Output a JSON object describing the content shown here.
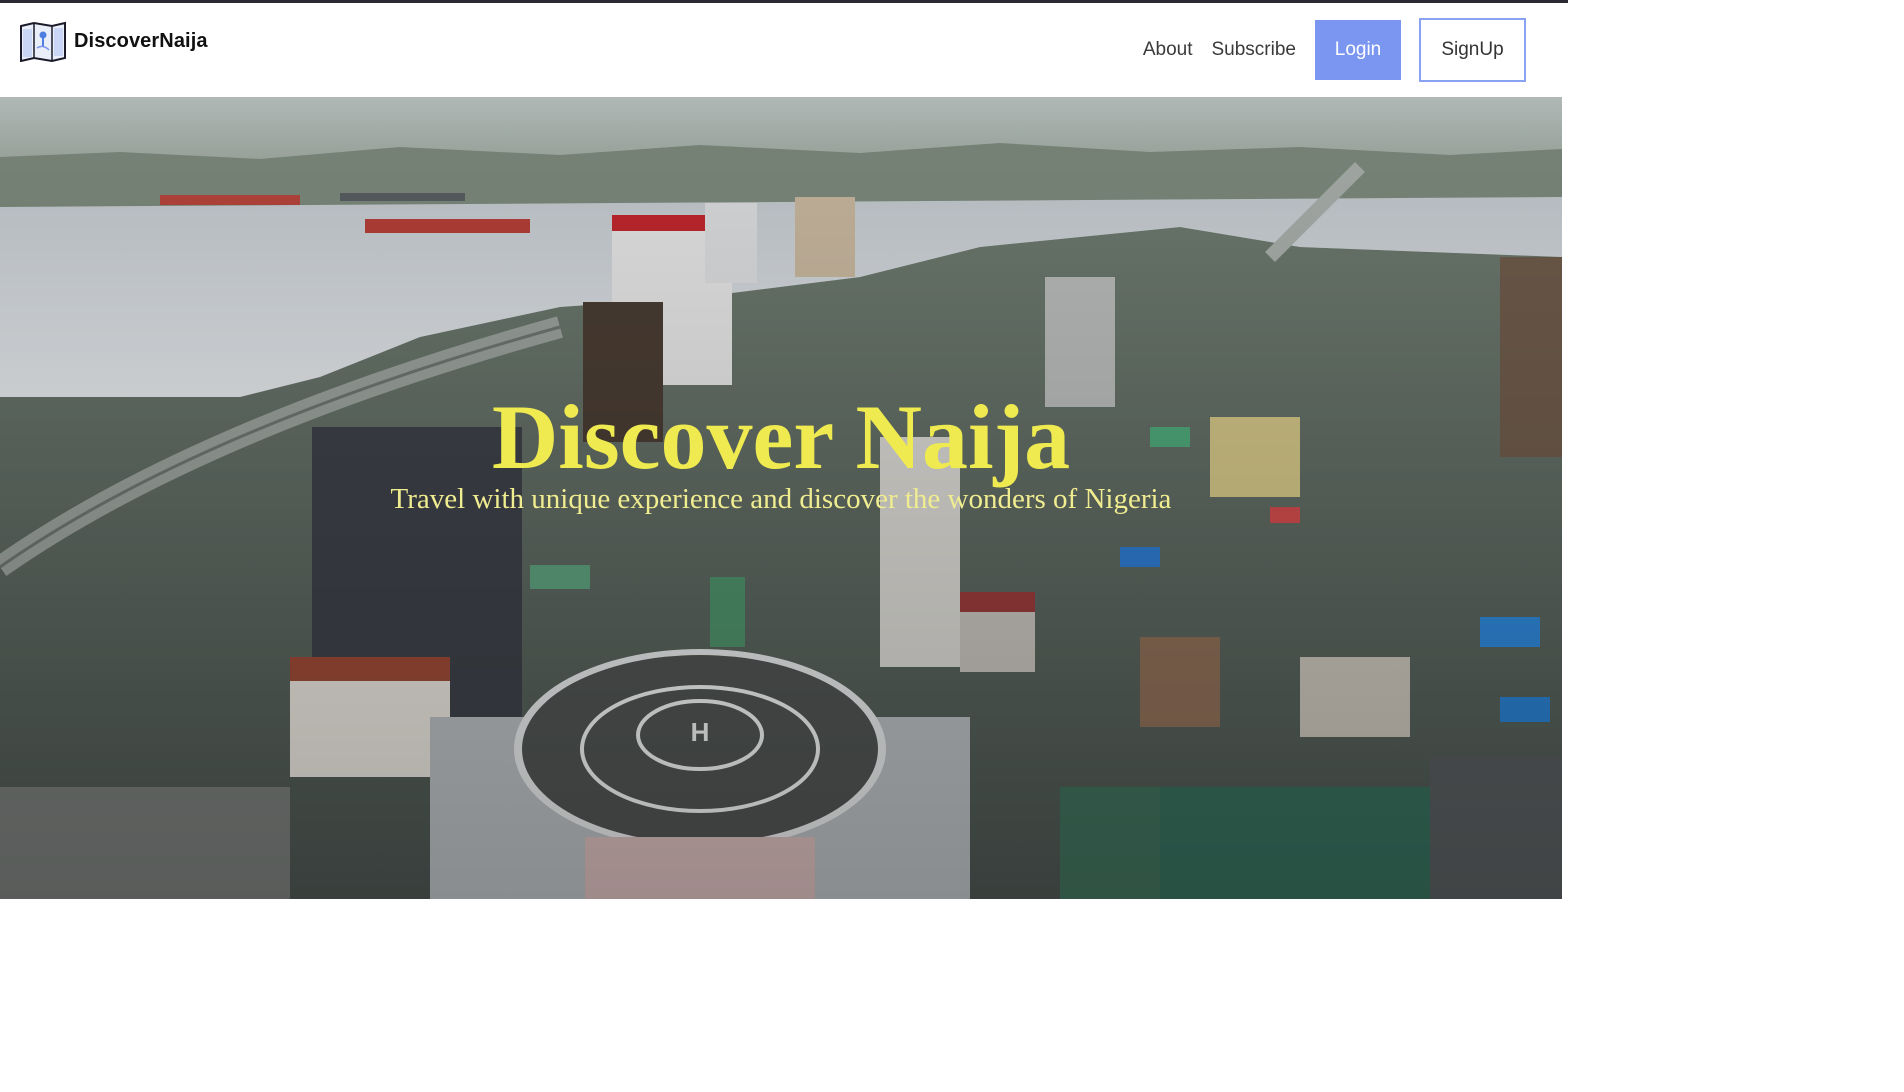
{
  "brand": {
    "name": "DiscoverNaija",
    "logo_icon": "map-book-icon"
  },
  "nav": {
    "about": "About",
    "subscribe": "Subscribe",
    "login": "Login",
    "signup": "SignUp"
  },
  "hero": {
    "title": "Discover Naija",
    "subtitle": "Travel with unique experience and discover the wonders of Nigeria",
    "background": "aerial-city-lagoon-photo"
  },
  "colors": {
    "accent": "#7b96f0",
    "title": "#eeea50"
  }
}
